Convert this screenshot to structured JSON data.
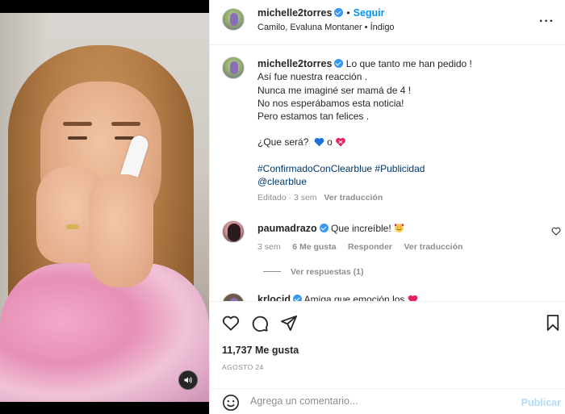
{
  "post": {
    "author": "michelle2torres",
    "follow_label": "Seguir",
    "subline": "Camilo, Evaluna Montaner • Índigo"
  },
  "caption": {
    "author": "michelle2torres",
    "lines": [
      "Lo que tanto me han pedido !",
      "Así fue nuestra reacción .",
      "Nunca me imaginé ser mamá de 4 !",
      "No nos esperábamos esta noticia!",
      "Pero estamos tan felices ."
    ],
    "question": "¿Que será?",
    "question_or": "o",
    "hashtags": "#ConfirmadoConClearblue #Publicidad",
    "mention": "@clearblue",
    "edited": "Editado · 3 sem",
    "see_translation": "Ver traducción"
  },
  "comment1": {
    "author": "paumadrazo",
    "text": "Que increíble!",
    "time": "3 sem",
    "likes": "6 Me gusta",
    "reply": "Responder",
    "see_translation": "Ver traducción",
    "view_replies": "Ver respuestas (1)"
  },
  "comment2": {
    "author": "krlocid",
    "text": "Amiga que emoción los"
  },
  "actions": {
    "likes": "11,737 Me gusta",
    "date": "AGOSTO 24"
  },
  "composer": {
    "placeholder": "Agrega un comentario...",
    "publish": "Publicar"
  },
  "colors": {
    "accent": "#0095f6",
    "verified": "#3897f0",
    "muted": "#8e8e8e",
    "link": "#00376b"
  }
}
